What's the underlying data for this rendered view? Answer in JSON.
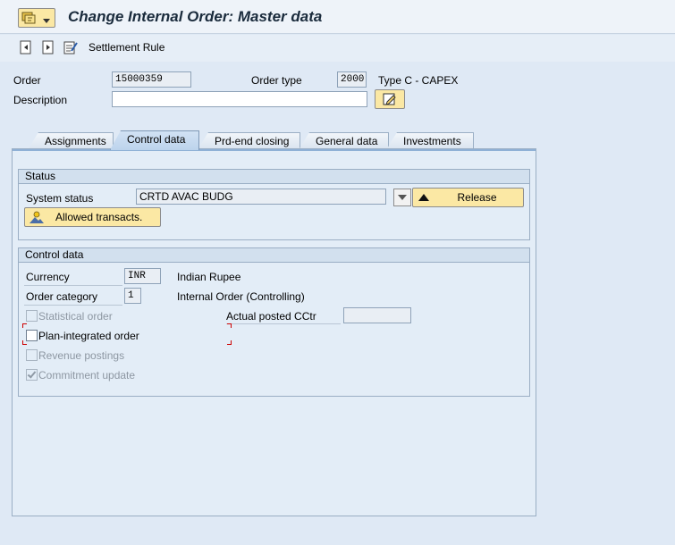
{
  "window": {
    "title": "Change Internal Order: Master data"
  },
  "toolbar": {
    "settlement_rule_label": "Settlement Rule"
  },
  "header": {
    "order_label": "Order",
    "order_value": "15000359",
    "order_type_label": "Order type",
    "order_type_value": "2000",
    "order_type_desc": "Type C  - CAPEX",
    "description_label": "Description",
    "description_value": ""
  },
  "tabs": [
    {
      "label": "Assignments",
      "active": false
    },
    {
      "label": "Control data",
      "active": true
    },
    {
      "label": "Prd-end closing",
      "active": false
    },
    {
      "label": "General data",
      "active": false
    },
    {
      "label": "Investments",
      "active": false
    }
  ],
  "status": {
    "group_title": "Status",
    "system_status_label": "System status",
    "system_status_value": "CRTD AVAC BUDG",
    "release_button": "Release",
    "allowed_transacts_button": "Allowed transacts."
  },
  "control": {
    "group_title": "Control data",
    "currency_label": "Currency",
    "currency_value": "INR",
    "currency_desc": "Indian Rupee",
    "order_category_label": "Order category",
    "order_category_value": "1",
    "order_category_desc": "Internal Order (Controlling)",
    "statistical_order_label": "Statistical order",
    "statistical_order_checked": false,
    "actual_posted_cctr_label": "Actual posted CCtr",
    "actual_posted_cctr_value": "",
    "plan_integrated_label": "Plan-integrated order",
    "plan_integrated_checked": false,
    "revenue_postings_label": "Revenue postings",
    "revenue_postings_checked": false,
    "commitment_update_label": "Commitment update",
    "commitment_update_checked": true
  },
  "colors": {
    "button_yellow": "#fbe8a4",
    "background": "#dfe9f5",
    "focus_red": "#cc0000"
  }
}
